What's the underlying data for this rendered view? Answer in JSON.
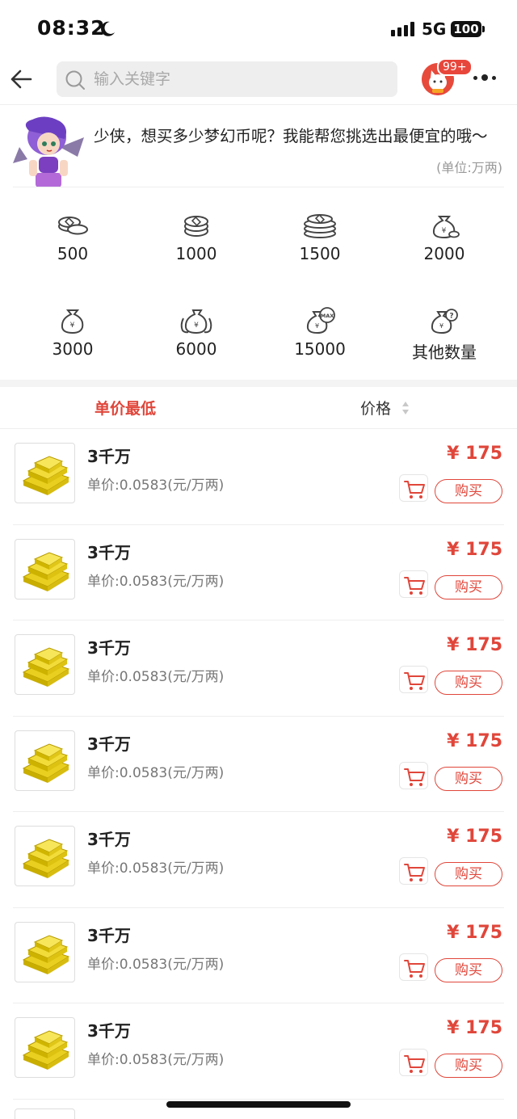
{
  "status_bar": {
    "time": "08:32",
    "network": "5G",
    "battery": "100"
  },
  "header": {
    "search_placeholder": "输入关键字",
    "badge": "99+"
  },
  "intro": {
    "message": "少侠，想买多少梦幻币呢？我能帮您挑选出最便宜的哦～",
    "unit": "(单位:万两)"
  },
  "amount_options": [
    {
      "label": "500",
      "icon": "coins-stack-small-icon"
    },
    {
      "label": "1000",
      "icon": "coins-stack-icon"
    },
    {
      "label": "1500",
      "icon": "coins-stack-large-icon"
    },
    {
      "label": "2000",
      "icon": "money-bag-icon"
    },
    {
      "label": "3000",
      "icon": "money-bag-icon"
    },
    {
      "label": "6000",
      "icon": "money-bags-icon"
    },
    {
      "label": "15000",
      "icon": "money-bag-max-icon"
    },
    {
      "label": "其他数量",
      "icon": "money-bag-question-icon"
    }
  ],
  "sort": {
    "lowest_unit_price": "单价最低",
    "price": "价格"
  },
  "listings": [
    {
      "title": "3千万",
      "unit_price": "单价:0.0583(元/万两)",
      "price": "¥ 175",
      "buy": "购买"
    },
    {
      "title": "3千万",
      "unit_price": "单价:0.0583(元/万两)",
      "price": "¥ 175",
      "buy": "购买"
    },
    {
      "title": "3千万",
      "unit_price": "单价:0.0583(元/万两)",
      "price": "¥ 175",
      "buy": "购买"
    },
    {
      "title": "3千万",
      "unit_price": "单价:0.0583(元/万两)",
      "price": "¥ 175",
      "buy": "购买"
    },
    {
      "title": "3千万",
      "unit_price": "单价:0.0583(元/万两)",
      "price": "¥ 175",
      "buy": "购买"
    },
    {
      "title": "3千万",
      "unit_price": "单价:0.0583(元/万两)",
      "price": "¥ 175",
      "buy": "购买"
    },
    {
      "title": "3千万",
      "unit_price": "单价:0.0583(元/万两)",
      "price": "¥ 175",
      "buy": "购买"
    }
  ],
  "colors": {
    "accent": "#e0463a",
    "divider": "#eeeeee",
    "search_bg": "#eeeeee"
  }
}
